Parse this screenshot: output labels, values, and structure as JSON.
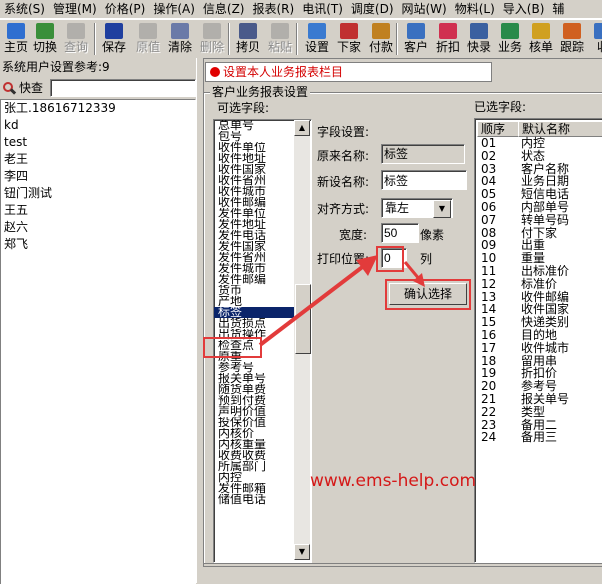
{
  "menu": [
    "系统(S)",
    "管理(M)",
    "价格(P)",
    "操作(A)",
    "信息(Z)",
    "报表(R)",
    "电讯(T)",
    "调度(D)",
    "网站(W)",
    "物料(L)",
    "导入(B)",
    "辅"
  ],
  "toolbar": [
    {
      "label": "主页",
      "icon": "home-icon",
      "color": "#2f6fd0",
      "enabled": true
    },
    {
      "label": "切换",
      "icon": "switch-icon",
      "color": "#3a8f3a",
      "enabled": true
    },
    {
      "label": "查询",
      "icon": "query-icon",
      "color": "#888888",
      "enabled": false
    },
    {
      "label": "保存",
      "icon": "save-icon",
      "color": "#1f3f9f",
      "enabled": true
    },
    {
      "label": "原值",
      "icon": "restore-icon",
      "color": "#888888",
      "enabled": false
    },
    {
      "label": "清除",
      "icon": "clear-icon",
      "color": "#6a7aa8",
      "enabled": true
    },
    {
      "label": "删除",
      "icon": "delete-icon",
      "color": "#888888",
      "enabled": false
    },
    {
      "label": "拷贝",
      "icon": "copy-icon",
      "color": "#4a5a8a",
      "enabled": true
    },
    {
      "label": "粘贴",
      "icon": "paste-icon",
      "color": "#888888",
      "enabled": false
    },
    {
      "label": "设置",
      "icon": "settings-icon",
      "color": "#3a7ad0",
      "enabled": true
    },
    {
      "label": "下家",
      "icon": "downstream-icon",
      "color": "#c03030",
      "enabled": true
    },
    {
      "label": "付款",
      "icon": "payment-icon",
      "color": "#c08020",
      "enabled": true
    },
    {
      "label": "客户",
      "icon": "customer-icon",
      "color": "#3a70c0",
      "enabled": true
    },
    {
      "label": "折扣",
      "icon": "discount-icon",
      "color": "#d03050",
      "enabled": true
    },
    {
      "label": "快录",
      "icon": "quick-entry-icon",
      "color": "#3a60a0",
      "enabled": true
    },
    {
      "label": "业务",
      "icon": "business-icon",
      "color": "#2a8a4a",
      "enabled": true
    },
    {
      "label": "核单",
      "icon": "verify-icon",
      "color": "#d0a020",
      "enabled": true
    },
    {
      "label": "跟踪",
      "icon": "track-icon",
      "color": "#d06020",
      "enabled": true
    },
    {
      "label": "收",
      "icon": "receive-icon",
      "color": "#3a70c0",
      "enabled": true
    }
  ],
  "left": {
    "title": "系统用户设置参考:9",
    "search_label": "快查",
    "search_value": "",
    "users": [
      "张工.18616712339",
      "kd",
      "test",
      "老王",
      "李四",
      "钮门测试",
      "王五",
      "赵六",
      "郑飞"
    ]
  },
  "banner": "设置本人业务报表栏目",
  "group_title": "客户业务报表设置",
  "available_label": "可选字段:",
  "available_fields": [
    "总单号",
    "包号",
    "收件单位",
    "收件地址",
    "收件国家",
    "收件省州",
    "收件城市",
    "收件邮编",
    "发件单位",
    "发件地址",
    "发件电话",
    "发件国家",
    "发件省州",
    "发件城市",
    "发件邮编",
    "货币",
    "产地",
    "标签",
    "出货损点",
    "出货操作",
    "检查点",
    "原重",
    "参考号",
    "报关单号",
    "随货单费",
    "预到付费",
    "声明价值",
    "投保价值",
    "内核价",
    "内核重量",
    "收费收费",
    "所属部门",
    "内控",
    "发件邮箱",
    "储值电话"
  ],
  "selected_field_index": 17,
  "field_settings": {
    "title": "字段设置:",
    "original_name_label": "原来名称:",
    "original_name": "标签",
    "new_name_label": "新设名称:",
    "new_name": "标签",
    "align_label": "对齐方式:",
    "align_value": "靠左",
    "width_label": "宽度:",
    "width_value": "50",
    "width_unit": "像素",
    "print_pos_label": "打印位置:",
    "print_pos_value": "0",
    "print_pos_unit": "列",
    "confirm_label": "确认选择"
  },
  "chosen_label": "已选字段:",
  "chosen_headers": [
    "顺序",
    "默认名称"
  ],
  "chosen_rows": [
    [
      "01",
      "内控"
    ],
    [
      "02",
      "状态"
    ],
    [
      "03",
      "客户名称"
    ],
    [
      "04",
      "业务日期"
    ],
    [
      "05",
      "短信电话"
    ],
    [
      "06",
      "内部单号"
    ],
    [
      "07",
      "转单号码"
    ],
    [
      "08",
      "付下家"
    ],
    [
      "09",
      "出重"
    ],
    [
      "10",
      "重量"
    ],
    [
      "11",
      "出标准价"
    ],
    [
      "12",
      "标准价"
    ],
    [
      "13",
      "收件邮编"
    ],
    [
      "14",
      "收件国家"
    ],
    [
      "15",
      "快递类别"
    ],
    [
      "16",
      "目的地"
    ],
    [
      "17",
      "收件城市"
    ],
    [
      "18",
      "留用串"
    ],
    [
      "19",
      "折扣价"
    ],
    [
      "20",
      "参考号"
    ],
    [
      "21",
      "报关单号"
    ],
    [
      "22",
      "类型"
    ],
    [
      "23",
      "备用二"
    ],
    [
      "24",
      "备用三"
    ]
  ],
  "watermark": "www.ems-help.com",
  "colors": {
    "highlight": "#e23b3b",
    "banner_dot": "#e00000",
    "banner_text": "#d40000",
    "selection": "#0a246a",
    "watermark": "#d51818"
  }
}
